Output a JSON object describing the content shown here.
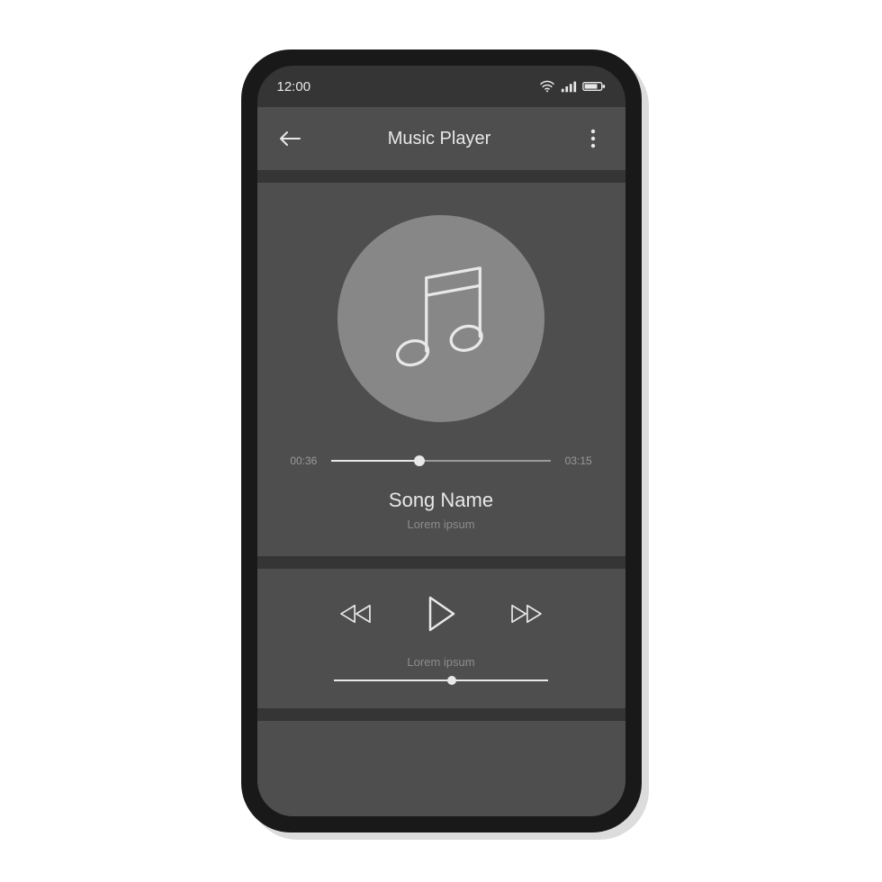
{
  "status": {
    "time": "12:00"
  },
  "header": {
    "title": "Music Player"
  },
  "player": {
    "elapsed": "00:36",
    "duration": "03:15",
    "progress_percent": 40,
    "song_name": "Song Name",
    "song_sub": "Lorem ipsum"
  },
  "controls": {
    "volume_label": "Lorem ipsum",
    "volume_percent": 55
  },
  "colors": {
    "phone_body": "#191919",
    "screen_bg": "#353535",
    "panel_bg": "#4e4e4e",
    "art_circle": "#878787",
    "text_light": "#e8e8e8",
    "text_muted": "#8c8c8c"
  }
}
